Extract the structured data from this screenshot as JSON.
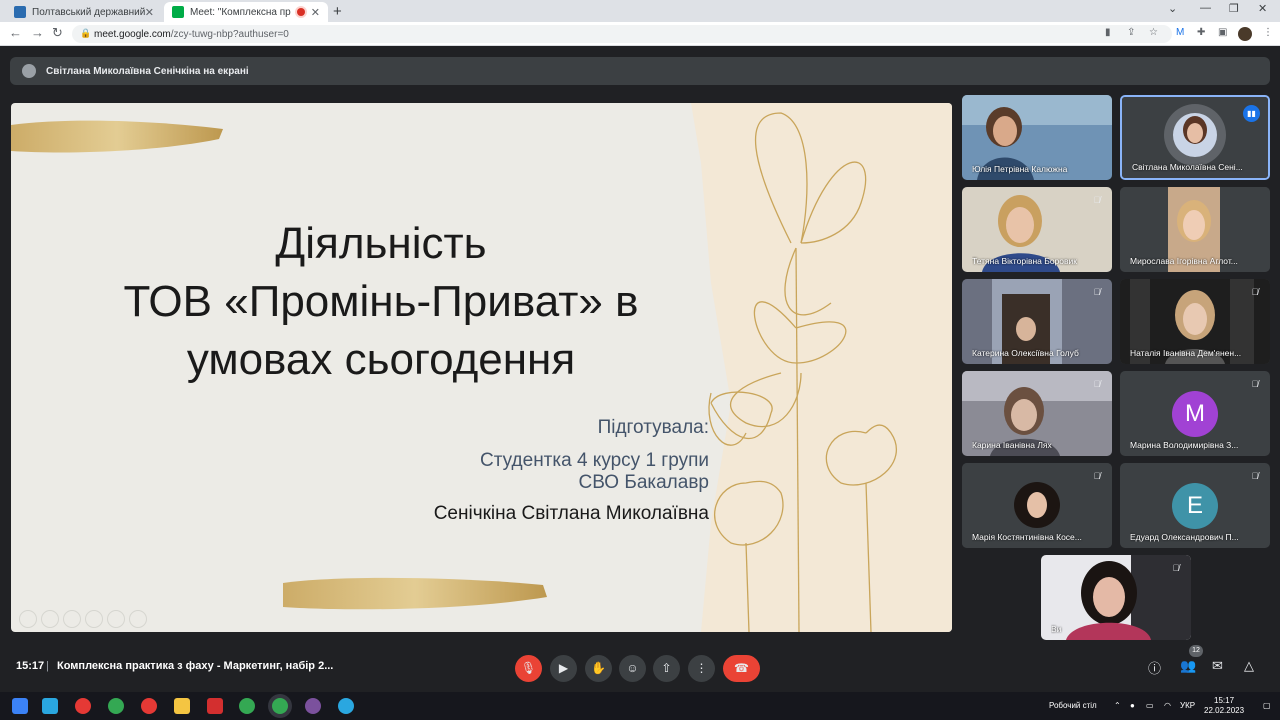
{
  "browser": {
    "tabs": [
      {
        "title": "Полтавський державний аграр",
        "active": false
      },
      {
        "title": "Meet: \"Комплексна практи",
        "active": true
      }
    ],
    "url_host": "meet.google.com",
    "url_path": "/zcy-tuwg-nbp?authuser=0"
  },
  "banner": {
    "text": "Світлана Миколаївна Сенічкіна на екрані"
  },
  "slide": {
    "title_line1": "Діяльність",
    "title_line2": "ТОВ «Промінь-Приват» в",
    "title_line3": "умовах сьогодення",
    "prepared_label": "Підготувала:",
    "student_line1": "Студентка 4 курсу 1 групи",
    "student_line2": "СВО Бакалавр",
    "author": "Сенічкіна Світлана Миколаївна"
  },
  "participants": [
    {
      "name": "Юлія Петрівна Калюжна"
    },
    {
      "name": "Світлана Миколаївна Сені..."
    },
    {
      "name": "Тетяна Вікторівна Боровик"
    },
    {
      "name": "Мирослава Ігорівна Аглот..."
    },
    {
      "name": "Катерина Олексіївна Голуб"
    },
    {
      "name": "Наталія Іванівна Дем'янен..."
    },
    {
      "name": "Карина Іванівна Лях"
    },
    {
      "name": "Марина Володимирівна З...",
      "initial": "M"
    },
    {
      "name": "Марія Костянтинівна Косе..."
    },
    {
      "name": "Едуард Олександрович П...",
      "initial": "E"
    },
    {
      "name": "Ви"
    }
  ],
  "meetbar": {
    "time": "15:17",
    "separator": "|",
    "meeting_title": "Комплексна практика з фаху - Маркетинг, набір 2...",
    "people_count": "12"
  },
  "taskbar": {
    "desktop_label": "Робочий стіл",
    "language": "УКР",
    "time": "15:17",
    "date": "22.02.2023"
  },
  "colors": {
    "accent": "#8ab4f8",
    "end_call": "#ea4335",
    "avatar_m": "#a142d4",
    "avatar_e": "#3f93a8"
  }
}
